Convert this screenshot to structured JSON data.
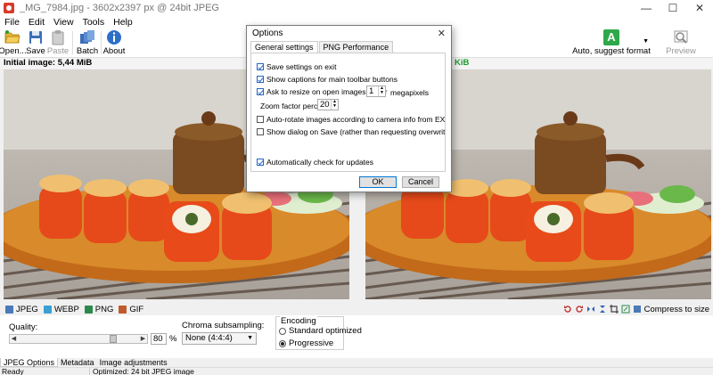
{
  "window": {
    "title": "_MG_7984.jpg - 3602x2397 px @ 24bit JPEG",
    "minimize": "—",
    "maximize": "☐",
    "close": "✕"
  },
  "menu": [
    "File",
    "Edit",
    "View",
    "Tools",
    "Help"
  ],
  "toolbar": {
    "open": "Open...",
    "save": "Save",
    "paste": "Paste",
    "batch": "Batch",
    "about": "About",
    "auto_format": "Auto, suggest format",
    "auto_format_icon": "A",
    "preview": "Preview"
  },
  "infobar": {
    "initial_image": "Initial image: 5,44 MiB",
    "optimized": "KiB"
  },
  "formats": {
    "tabs": [
      {
        "label": "JPEG",
        "color": "#4a7ab8"
      },
      {
        "label": "WEBP",
        "color": "#3aa0d0"
      },
      {
        "label": "PNG",
        "color": "#2a8a4a"
      },
      {
        "label": "GIF",
        "color": "#c05a2a"
      }
    ],
    "compress_to_size": "Compress to size"
  },
  "jpeg_options": {
    "quality_label": "Quality:",
    "quality_value": "80",
    "quality_fraction": 0.8,
    "percent": "%",
    "chroma_label": "Chroma subsampling:",
    "chroma_value": "None (4:4:4)",
    "encoding_label": "Encoding",
    "encoding_standard": "Standard optimized",
    "encoding_progressive": "Progressive"
  },
  "bottom_tabs": [
    "JPEG Options",
    "Metadata",
    "Image adjustments"
  ],
  "status": {
    "left": "Ready",
    "mid": "Optimized: 24 bit JPEG image"
  },
  "dialog": {
    "title": "Options",
    "close": "✕",
    "tabs": [
      "General settings",
      "PNG Performance"
    ],
    "options": [
      {
        "label": "Save settings on exit",
        "checked": true
      },
      {
        "label": "Show captions for main toolbar buttons",
        "checked": true
      },
      {
        "label": "Ask to resize on open images larger",
        "checked": true
      },
      {
        "label": "Auto-rotate images according to camera info from EXIF profile",
        "checked": false
      },
      {
        "label": "Show dialog on Save (rather than requesting overwrite confirmation)",
        "checked": false
      },
      {
        "label": "Automatically check for updates",
        "checked": true
      }
    ],
    "resize_value": "1",
    "megapixels": "megapixels",
    "zoom_label": "Zoom factor percent:",
    "zoom_value": "20",
    "ok": "OK",
    "cancel": "Cancel"
  }
}
